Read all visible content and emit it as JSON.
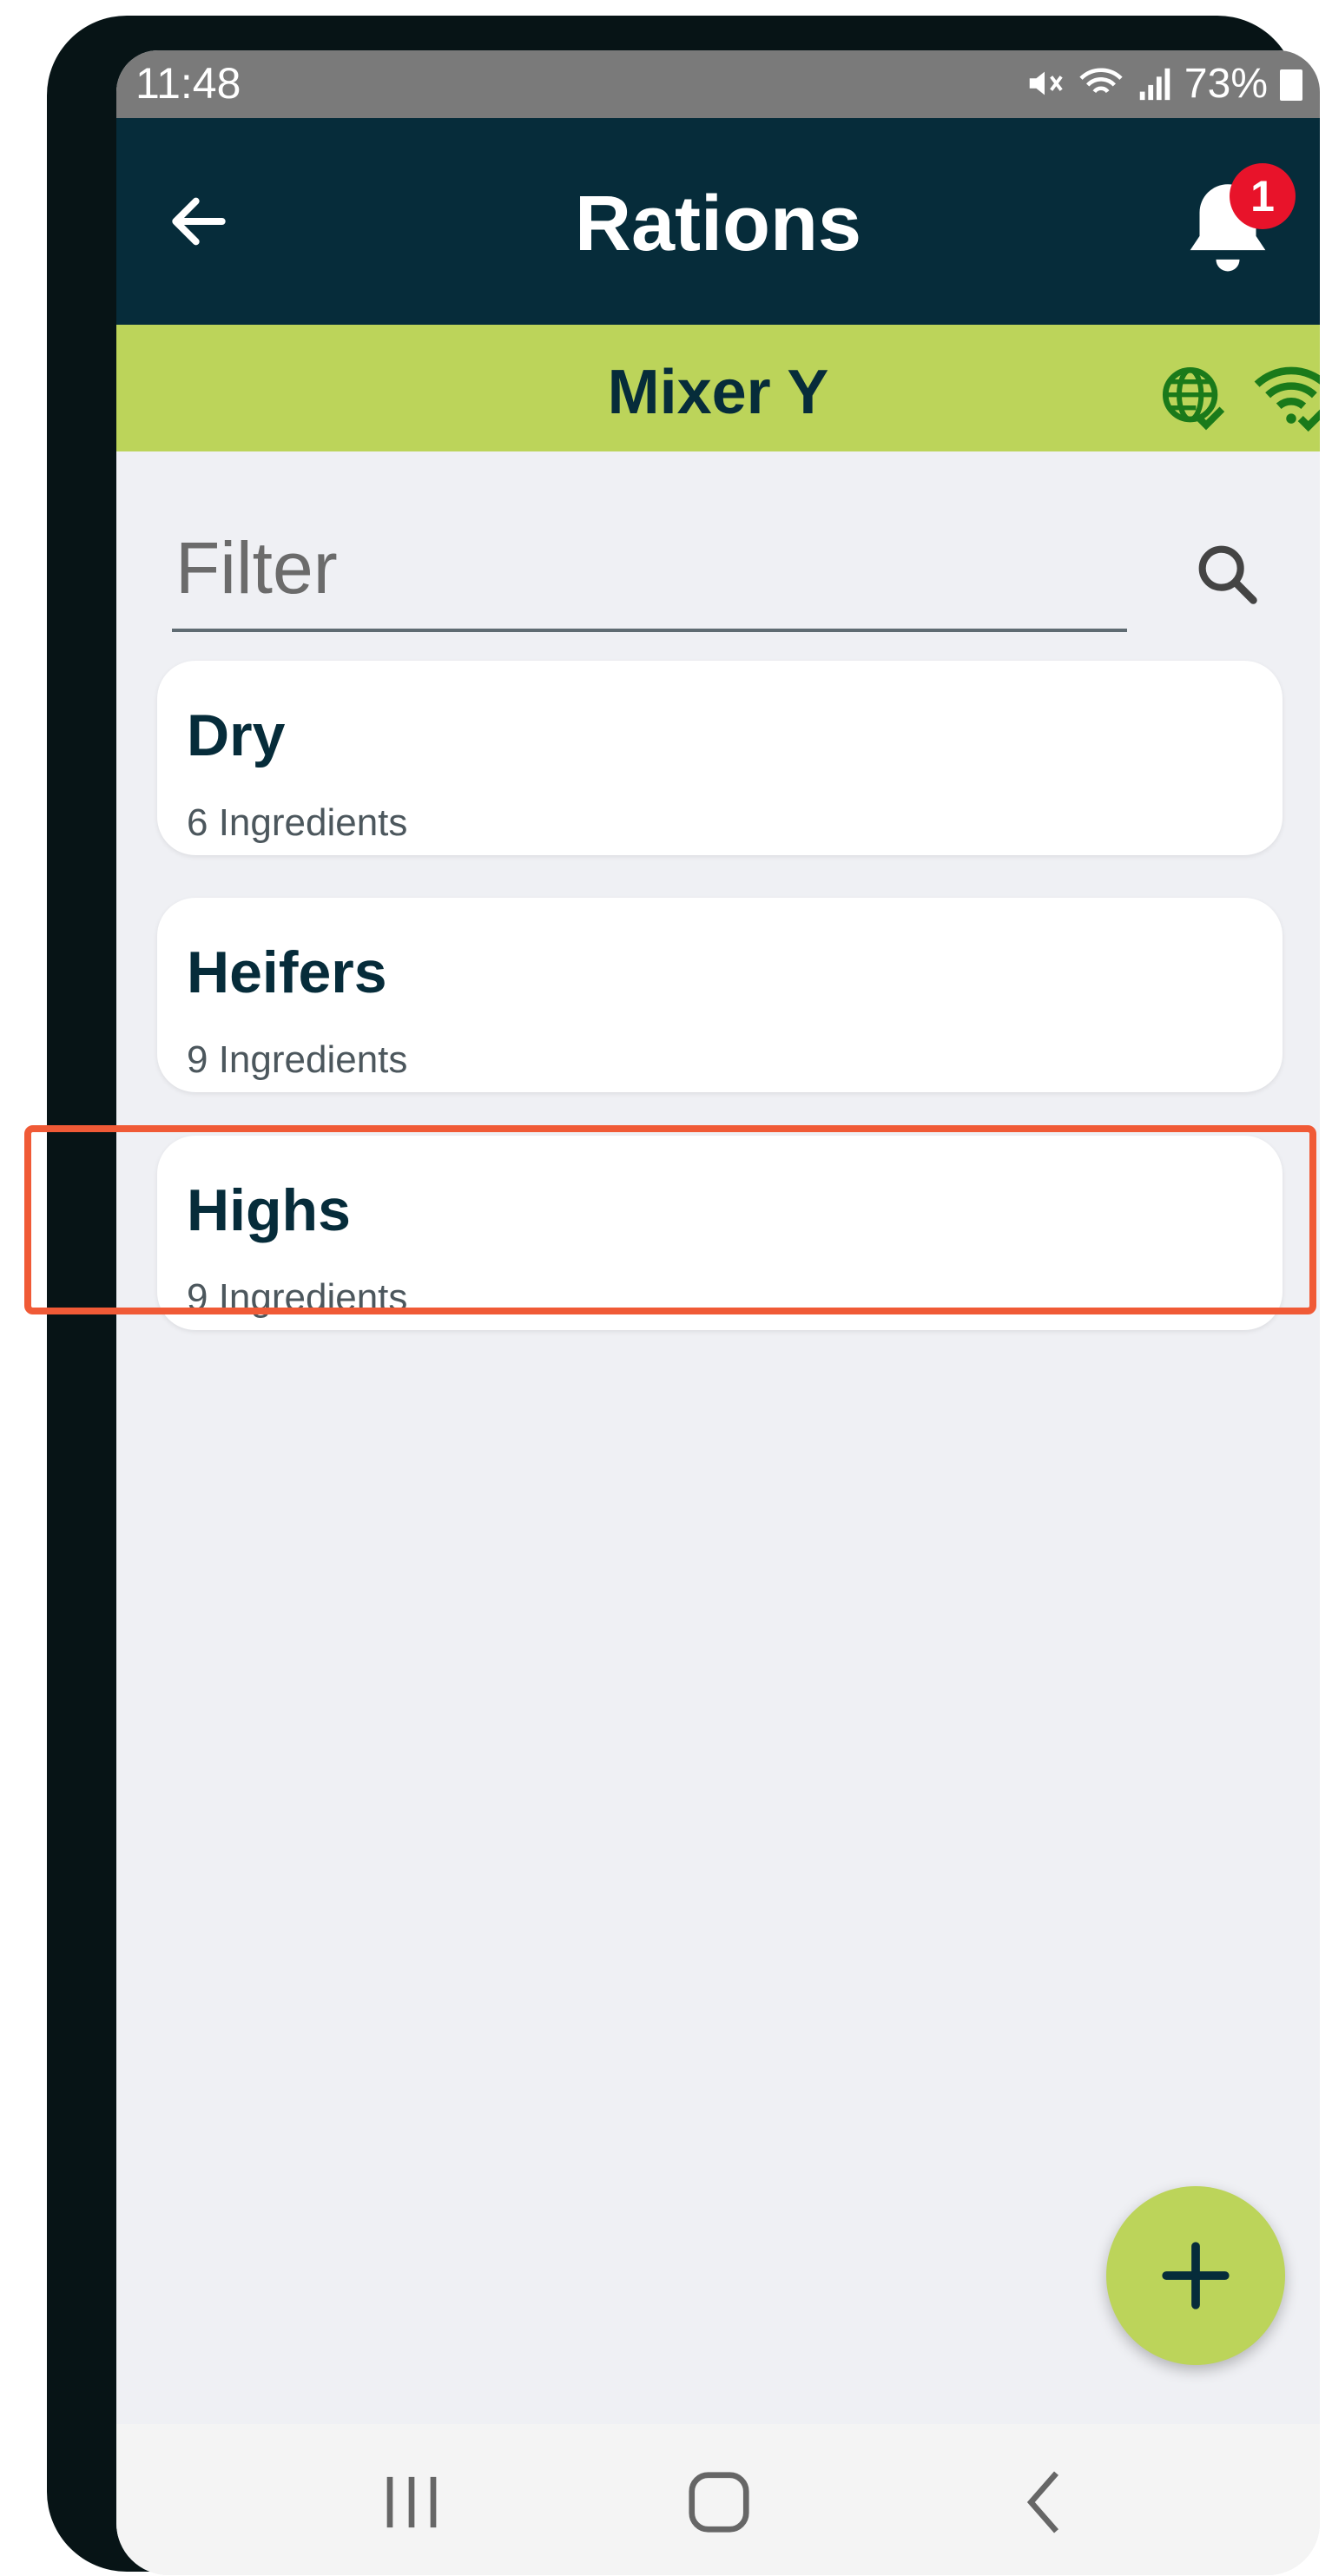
{
  "status_bar": {
    "time": "11:48",
    "battery": "73%"
  },
  "app_bar": {
    "title": "Rations",
    "notification_count": "1"
  },
  "sub_bar": {
    "title": "Mixer Y"
  },
  "filter": {
    "placeholder": "Filter",
    "value": ""
  },
  "rations": [
    {
      "name": "Dry",
      "ingredients": "6 Ingredients"
    },
    {
      "name": "Heifers",
      "ingredients": "9 Ingredients"
    },
    {
      "name": "Highs",
      "ingredients": "9 Ingredients"
    }
  ],
  "icons": {
    "back": "arrow-left-icon",
    "bell": "bell-icon",
    "globe": "globe-check-icon",
    "wifi": "wifi-check-icon",
    "search": "search-icon",
    "add": "plus-icon",
    "recents": "recent-apps-icon",
    "home": "home-icon",
    "nav_back": "chevron-left-icon"
  },
  "colors": {
    "app_bar": "#062c3a",
    "accent": "#bcd45a",
    "badge": "#e8132a",
    "highlight": "#f05a36",
    "status_icons": "#1a7a1a"
  }
}
